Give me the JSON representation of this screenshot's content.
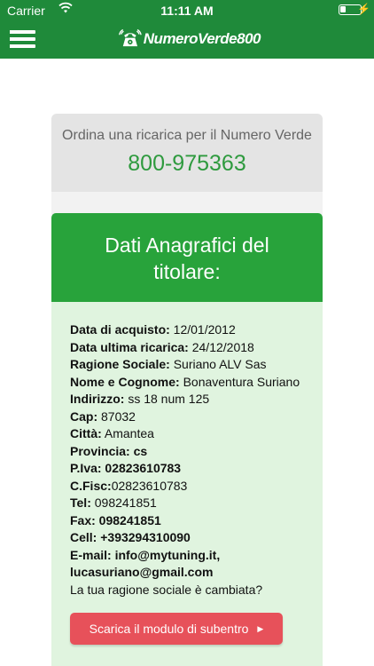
{
  "status_bar": {
    "carrier": "Carrier",
    "time": "11:11 AM"
  },
  "header": {
    "logo_text": "NumeroVerde800"
  },
  "order_card": {
    "title": "Ordina una ricarica per il Numero Verde",
    "phone_number": "800-975363"
  },
  "details_card": {
    "title": "Dati Anagrafici del titolare:",
    "rows": [
      {
        "label": "Data di acquisto:",
        "value": " 12/01/2012"
      },
      {
        "label": "Data ultima ricarica:",
        "value": " 24/12/2018"
      },
      {
        "label": "Ragione Sociale:",
        "value": " Suriano ALV Sas"
      },
      {
        "label": "Nome e Cognome:",
        "value": " Bonaventura Suriano"
      },
      {
        "label": "Indirizzo:",
        "value": " ss 18 num 125"
      },
      {
        "label": "Cap:",
        "value": " 87032"
      },
      {
        "label": "Città:",
        "value": " Amantea"
      },
      {
        "label": "Provincia:",
        "value": " cs"
      },
      {
        "label": "P.Iva:",
        "value": " 02823610783"
      },
      {
        "label": "C.Fisc:",
        "value": "02823610783"
      },
      {
        "label": "Tel:",
        "value": " 098241851"
      },
      {
        "label": "Fax:",
        "value": " 098241851"
      },
      {
        "label": "Cell:",
        "value": " +393294310090"
      },
      {
        "label": "E-mail:",
        "value": " info@mytuning.it,"
      }
    ],
    "email_cont": "lucasuriano@gmail.com",
    "question": "La tua ragione sociale è cambiata?",
    "download_button": "Scarica il modulo di subentro"
  },
  "colors": {
    "brand_green": "#1f8a3a",
    "header_green": "#28a33b",
    "phone_green": "#2e9a3e",
    "body_bg": "#e0f4df",
    "button_red": "#e7515a"
  }
}
